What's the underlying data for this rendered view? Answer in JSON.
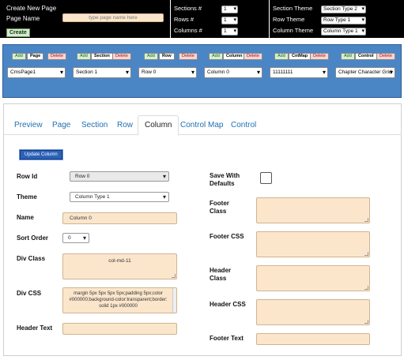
{
  "top": {
    "create_title": "Create New Page",
    "page_name_label": "Page Name",
    "page_name_placeholder": "type page name here",
    "create_button": "Create",
    "sections_label": "Sections #",
    "rows_label": "Rows #",
    "columns_label": "Columns #",
    "sections_value": "1",
    "rows_value": "1",
    "columns_value": "1",
    "section_theme_label": "Section Theme",
    "row_theme_label": "Row Theme",
    "column_theme_label": "Column Theme",
    "section_theme_value": "Section Type 2",
    "row_theme_value": "Row Type 1",
    "column_theme_value": "Column Type 1"
  },
  "toolbar": {
    "add_label": "Add",
    "delete_label": "Delete",
    "groups": [
      {
        "name": "Page",
        "value": "CmsPage1"
      },
      {
        "name": "Section",
        "value": "Section 1"
      },
      {
        "name": "Row",
        "value": "Row 0"
      },
      {
        "name": "Column",
        "value": "Column 0"
      },
      {
        "name": "CntMap",
        "value": "11111111"
      },
      {
        "name": "Control",
        "value": "Chapter Character Grid"
      }
    ]
  },
  "tabs": [
    "Preview",
    "Page",
    "Section",
    "Row",
    "Column",
    "Control Map",
    "Control"
  ],
  "active_tab": "Column",
  "form": {
    "update_button": "Update Column",
    "row_id_label": "Row Id",
    "row_id_value": "Row 0",
    "theme_label": "Theme",
    "theme_value": "Column Type 1",
    "name_label": "Name",
    "name_value": "Column 0",
    "sort_order_label": "Sort Order",
    "sort_order_value": "0",
    "div_class_label": "Div Class",
    "div_class_value": "col-md-11",
    "div_css_label": "Div CSS",
    "div_css_value": "margin 5px 5px 5px 5px;padding 5px;color #000000;background-color:transparent;border: solid 1px #000000",
    "header_text_label": "Header Text",
    "header_text_value": "",
    "save_defaults_label_1": "Save With",
    "save_defaults_label_2": "Defaults",
    "footer_class_label_1": "Footer",
    "footer_class_label_2": "Class",
    "footer_css_label": "Footer CSS",
    "header_class_label_1": "Header",
    "header_class_label_2": "Class",
    "header_css_label": "Header CSS",
    "footer_text_label": "Footer Text"
  }
}
